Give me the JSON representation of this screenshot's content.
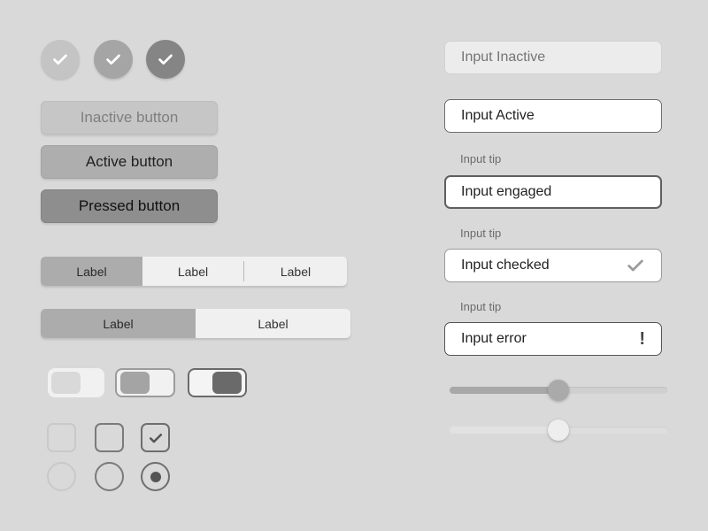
{
  "check_circles": [
    {
      "state": "inactive",
      "color": "#c4c4c4",
      "icon": "check-icon"
    },
    {
      "state": "active",
      "color": "#a5a5a5",
      "icon": "check-icon"
    },
    {
      "state": "pressed",
      "color": "#858585",
      "icon": "check-icon"
    }
  ],
  "buttons": {
    "inactive_label": "Inactive button",
    "active_label": "Active button",
    "pressed_label": "Pressed button"
  },
  "segmented_three": {
    "selected_index": 0,
    "items": [
      "Label",
      "Label",
      "Label"
    ]
  },
  "segmented_two": {
    "selected_index": 0,
    "items": [
      "Label",
      "Label"
    ]
  },
  "toggles": [
    {
      "state": "inactive"
    },
    {
      "state": "off"
    },
    {
      "state": "on"
    }
  ],
  "checkboxes": [
    {
      "state": "inactive",
      "checked": false
    },
    {
      "state": "active",
      "checked": false
    },
    {
      "state": "checked",
      "checked": true
    }
  ],
  "radios": [
    {
      "state": "inactive",
      "selected": false
    },
    {
      "state": "active",
      "selected": false
    },
    {
      "state": "selected",
      "selected": true
    }
  ],
  "inputs": {
    "inactive": {
      "placeholder": "Input Inactive"
    },
    "active": {
      "value": "Input Active"
    },
    "engaged": {
      "tip": "Input tip",
      "value": "Input engaged"
    },
    "checked": {
      "tip": "Input tip",
      "value": "Input checked",
      "icon": "check-icon"
    },
    "error": {
      "tip": "Input tip",
      "value": "Input error",
      "icon": "exclamation-icon",
      "mark": "!"
    }
  },
  "sliders": [
    {
      "state": "active",
      "value": 0.5,
      "fill_color": "#a8a8a8",
      "thumb_color": "#aaaaaa"
    },
    {
      "state": "inactive",
      "value": 0.5,
      "fill_color": "#e2e2e2",
      "thumb_color": "#eeeeee"
    }
  ]
}
